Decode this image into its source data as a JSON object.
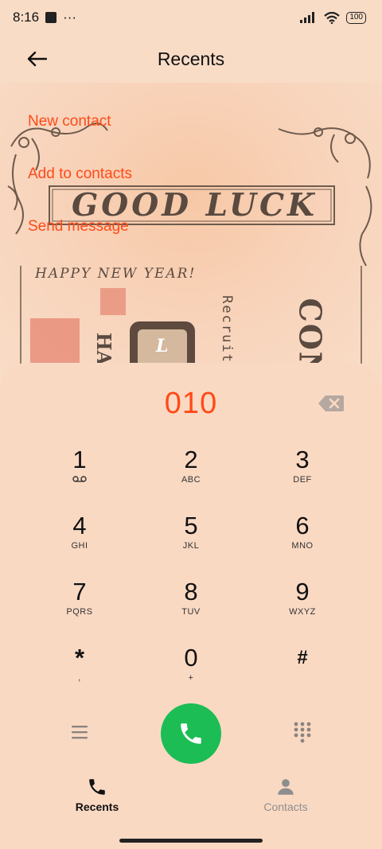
{
  "status_bar": {
    "time": "8:16",
    "more": "···",
    "battery": "100"
  },
  "header": {
    "title": "Recents"
  },
  "background_card": {
    "headline": "GOOD LUCK",
    "greeting": "HAPPY NEW YEAR!",
    "tag_letter": "L",
    "vertical_word": "Recruit",
    "vertical_partial": "CON",
    "vertical_partial_left": "HA"
  },
  "actions": {
    "new_contact": "New contact",
    "add_to_contacts": "Add to contacts",
    "send_message": "Send message"
  },
  "dialer": {
    "entered_number": "010",
    "keys": [
      {
        "digit": "1",
        "letters": ""
      },
      {
        "digit": "2",
        "letters": "ABC"
      },
      {
        "digit": "3",
        "letters": "DEF"
      },
      {
        "digit": "4",
        "letters": "GHI"
      },
      {
        "digit": "5",
        "letters": "JKL"
      },
      {
        "digit": "6",
        "letters": "MNO"
      },
      {
        "digit": "7",
        "letters": "PQRS"
      },
      {
        "digit": "8",
        "letters": "TUV"
      },
      {
        "digit": "9",
        "letters": "WXYZ"
      },
      {
        "digit": "*",
        "letters": ","
      },
      {
        "digit": "0",
        "letters": "+"
      },
      {
        "digit": "#",
        "letters": ""
      }
    ]
  },
  "nav": {
    "recents": "Recents",
    "contacts": "Contacts"
  },
  "colors": {
    "accent": "#ff4a17",
    "call_green": "#1dbd55",
    "background": "#f9dcc6"
  }
}
